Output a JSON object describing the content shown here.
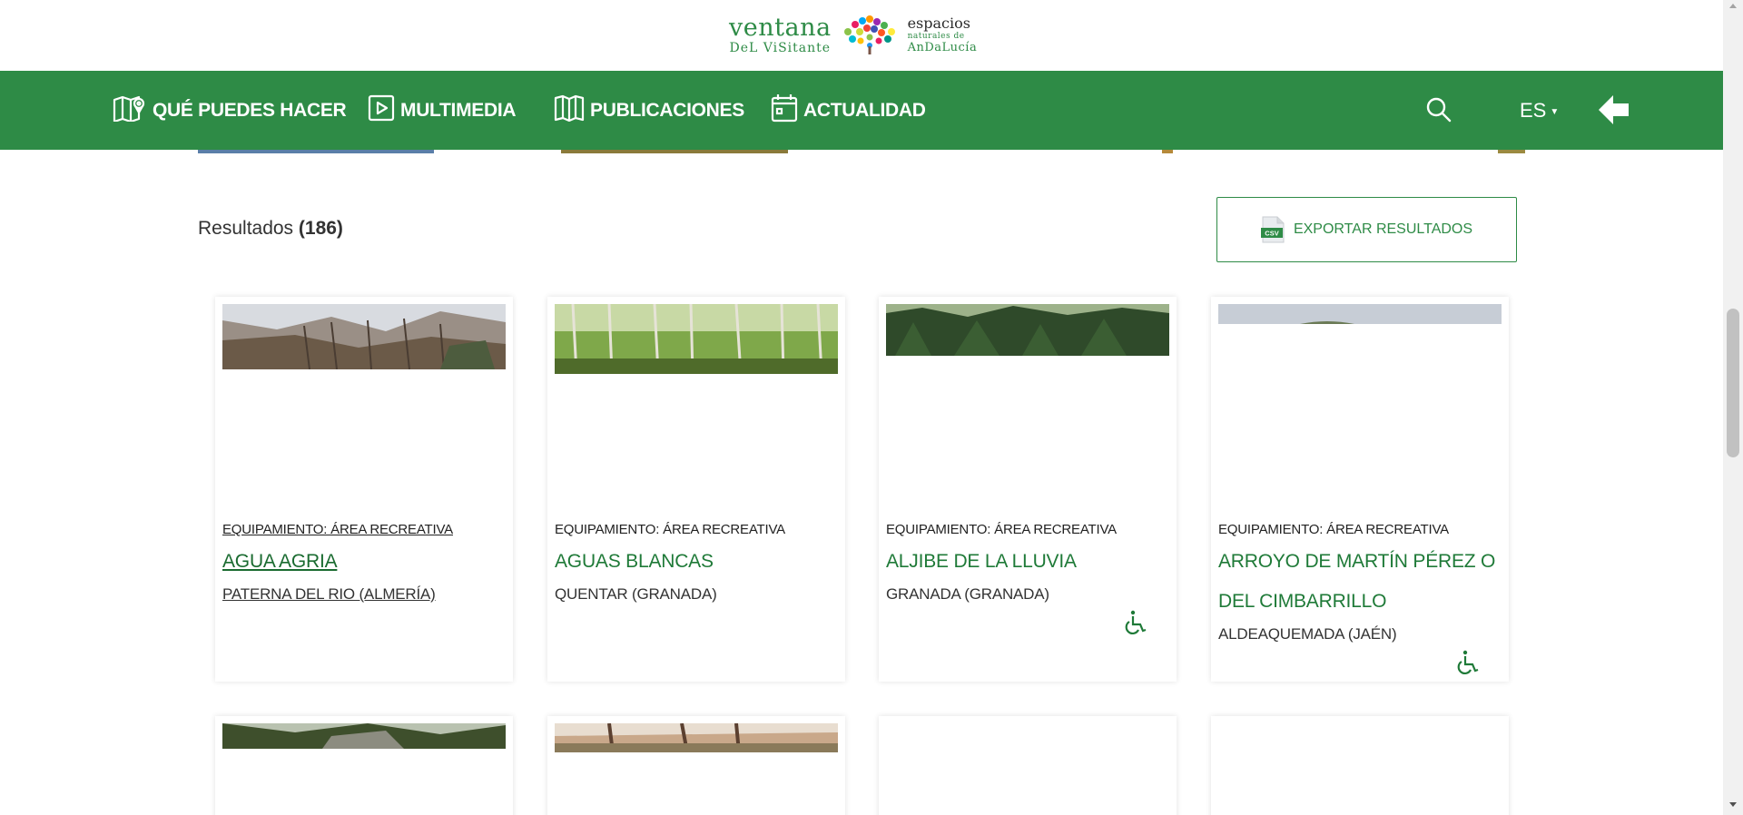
{
  "logo": {
    "line1": "ventana",
    "line2": "DeL ViSitante",
    "right1": "espacios",
    "right2": "naturales de",
    "right3": "AnDaLucía"
  },
  "nav": {
    "items": [
      {
        "label": "QUÉ PUEDES HACER",
        "icon": "map-pin-icon"
      },
      {
        "label": "MULTIMEDIA",
        "icon": "play-icon"
      },
      {
        "label": "PUBLICACIONES",
        "icon": "book-icon"
      },
      {
        "label": "ACTUALIDAD",
        "icon": "calendar-icon"
      }
    ],
    "search_icon": "search-icon",
    "lang": "ES",
    "back_icon": "arrow-left-icon"
  },
  "results": {
    "label": "Resultados",
    "count": "(186)",
    "export_label": "EXPORTAR RESULTADOS",
    "export_icon_text": "CSV"
  },
  "cards": [
    {
      "category": "EQUIPAMIENTO: ÁREA RECREATIVA",
      "title": "AGUA AGRIA",
      "location": "PATERNA DEL RIO (ALMERÍA)",
      "accessible": false,
      "active": true
    },
    {
      "category": "EQUIPAMIENTO: ÁREA RECREATIVA",
      "title": "AGUAS BLANCAS",
      "location": "QUENTAR (GRANADA)",
      "accessible": false,
      "active": false
    },
    {
      "category": "EQUIPAMIENTO: ÁREA RECREATIVA",
      "title": "ALJIBE DE LA LLUVIA",
      "location": "GRANADA (GRANADA)",
      "accessible": true,
      "active": false
    },
    {
      "category": "EQUIPAMIENTO: ÁREA RECREATIVA",
      "title": "ARROYO DE MARTÍN PÉREZ O DEL CIMBARRILLO",
      "location": "ALDEAQUEMADA (JAÉN)",
      "accessible": true,
      "active": false
    }
  ],
  "colors": {
    "brand_green": "#2e8b46",
    "title_green": "#1f7a38"
  }
}
